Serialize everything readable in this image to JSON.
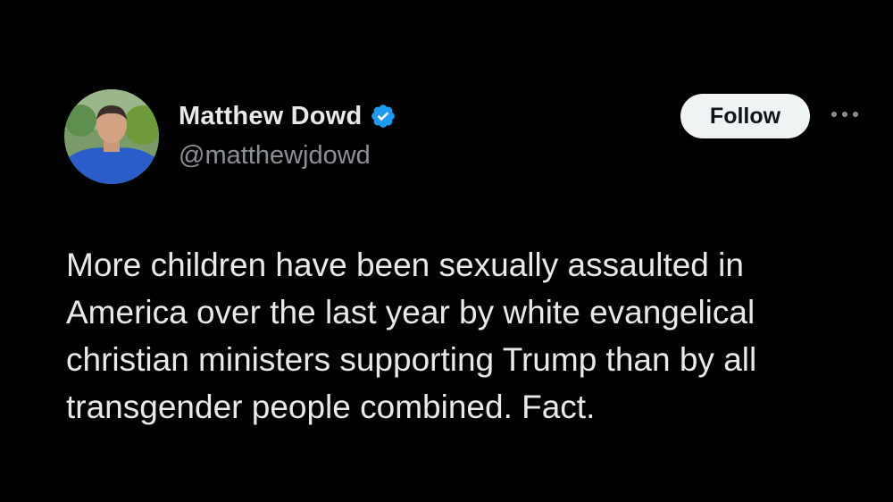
{
  "author": {
    "display_name": "Matthew Dowd",
    "handle": "@matthewjdowd",
    "verified": true,
    "verified_color": "#1d9bf0"
  },
  "actions": {
    "follow_label": "Follow",
    "more_icon": "more-horizontal-icon"
  },
  "tweet": {
    "lines": [
      "More children have been sexually assaulted in",
      "America over the last year by white evangelical",
      "christian ministers supporting Trump than by all",
      "transgender people combined.  Fact."
    ]
  },
  "colors": {
    "background": "#000000",
    "text_primary": "#e7e9ea",
    "text_secondary": "#8b9096",
    "button_bg": "#eff3f4"
  }
}
